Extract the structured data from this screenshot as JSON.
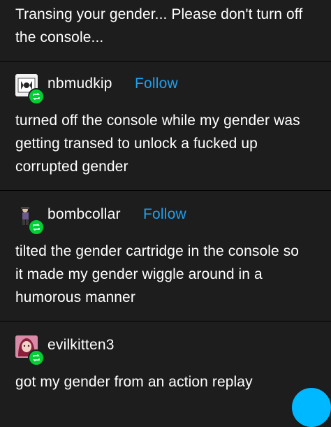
{
  "posts": [
    {
      "text": "Transing your gender... Please don't turn off the console..."
    },
    {
      "username": "nbmudkip",
      "follow_label": "Follow",
      "text": "turned off the console while my gender was getting transed to unlock a fucked up corrupted gender"
    },
    {
      "username": "bombcollar",
      "follow_label": "Follow",
      "text": "tilted the gender cartridge in the console so it made my gender wiggle around in a humorous manner"
    },
    {
      "username": "evilkitten3",
      "text": "got my gender from an action replay"
    }
  ],
  "colors": {
    "background": "#1d1d1d",
    "follow": "#1f9ff0",
    "reblog": "#00cf35",
    "divider": "#000000"
  },
  "icons": {
    "reblog": "reblog-icon",
    "fab": "floating-action-button"
  }
}
